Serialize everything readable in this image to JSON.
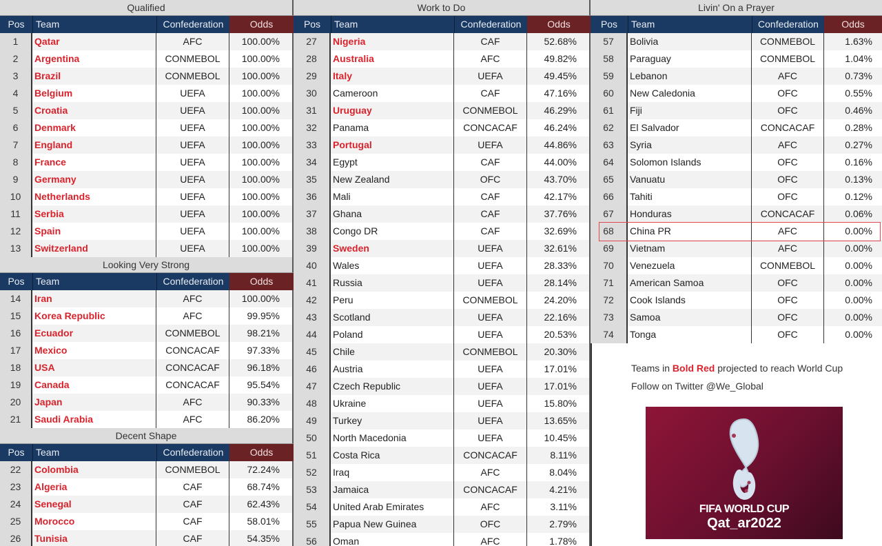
{
  "columns_header": {
    "pos": "Pos",
    "team": "Team",
    "confederation": "Confederation",
    "odds": "Odds"
  },
  "colors": {
    "bold_red": "#d9232c",
    "header_navy": "#1a3a63",
    "header_odds": "#6b2225",
    "highlight_box": "#e0484d"
  },
  "sections": {
    "qualified": {
      "title": "Qualified",
      "rows": [
        {
          "pos": "1",
          "team": "Qatar",
          "conf": "AFC",
          "odds": "100.00%",
          "bold_red": true
        },
        {
          "pos": "2",
          "team": "Argentina",
          "conf": "CONMEBOL",
          "odds": "100.00%",
          "bold_red": true
        },
        {
          "pos": "3",
          "team": "Brazil",
          "conf": "CONMEBOL",
          "odds": "100.00%",
          "bold_red": true
        },
        {
          "pos": "4",
          "team": "Belgium",
          "conf": "UEFA",
          "odds": "100.00%",
          "bold_red": true
        },
        {
          "pos": "5",
          "team": "Croatia",
          "conf": "UEFA",
          "odds": "100.00%",
          "bold_red": true
        },
        {
          "pos": "6",
          "team": "Denmark",
          "conf": "UEFA",
          "odds": "100.00%",
          "bold_red": true
        },
        {
          "pos": "7",
          "team": "England",
          "conf": "UEFA",
          "odds": "100.00%",
          "bold_red": true
        },
        {
          "pos": "8",
          "team": "France",
          "conf": "UEFA",
          "odds": "100.00%",
          "bold_red": true
        },
        {
          "pos": "9",
          "team": "Germany",
          "conf": "UEFA",
          "odds": "100.00%",
          "bold_red": true
        },
        {
          "pos": "10",
          "team": "Netherlands",
          "conf": "UEFA",
          "odds": "100.00%",
          "bold_red": true
        },
        {
          "pos": "11",
          "team": "Serbia",
          "conf": "UEFA",
          "odds": "100.00%",
          "bold_red": true
        },
        {
          "pos": "12",
          "team": "Spain",
          "conf": "UEFA",
          "odds": "100.00%",
          "bold_red": true
        },
        {
          "pos": "13",
          "team": "Switzerland",
          "conf": "UEFA",
          "odds": "100.00%",
          "bold_red": true
        }
      ]
    },
    "looking_very_strong": {
      "title": "Looking Very Strong",
      "rows": [
        {
          "pos": "14",
          "team": "Iran",
          "conf": "AFC",
          "odds": "100.00%",
          "bold_red": true
        },
        {
          "pos": "15",
          "team": "Korea Republic",
          "conf": "AFC",
          "odds": "99.95%",
          "bold_red": true
        },
        {
          "pos": "16",
          "team": "Ecuador",
          "conf": "CONMEBOL",
          "odds": "98.21%",
          "bold_red": true
        },
        {
          "pos": "17",
          "team": "Mexico",
          "conf": "CONCACAF",
          "odds": "97.33%",
          "bold_red": true
        },
        {
          "pos": "18",
          "team": "USA",
          "conf": "CONCACAF",
          "odds": "96.18%",
          "bold_red": true
        },
        {
          "pos": "19",
          "team": "Canada",
          "conf": "CONCACAF",
          "odds": "95.54%",
          "bold_red": true
        },
        {
          "pos": "20",
          "team": "Japan",
          "conf": "AFC",
          "odds": "90.33%",
          "bold_red": true
        },
        {
          "pos": "21",
          "team": "Saudi Arabia",
          "conf": "AFC",
          "odds": "86.20%",
          "bold_red": true
        }
      ]
    },
    "decent_shape": {
      "title": "Decent Shape",
      "rows": [
        {
          "pos": "22",
          "team": "Colombia",
          "conf": "CONMEBOL",
          "odds": "72.24%",
          "bold_red": true
        },
        {
          "pos": "23",
          "team": "Algeria",
          "conf": "CAF",
          "odds": "68.74%",
          "bold_red": true
        },
        {
          "pos": "24",
          "team": "Senegal",
          "conf": "CAF",
          "odds": "62.43%",
          "bold_red": true
        },
        {
          "pos": "25",
          "team": "Morocco",
          "conf": "CAF",
          "odds": "58.01%",
          "bold_red": true
        },
        {
          "pos": "26",
          "team": "Tunisia",
          "conf": "CAF",
          "odds": "54.35%",
          "bold_red": true
        }
      ]
    },
    "work_to_do": {
      "title": "Work to Do",
      "rows": [
        {
          "pos": "27",
          "team": "Nigeria",
          "conf": "CAF",
          "odds": "52.68%",
          "bold_red": true
        },
        {
          "pos": "28",
          "team": "Australia",
          "conf": "AFC",
          "odds": "49.82%",
          "bold_red": true
        },
        {
          "pos": "29",
          "team": "Italy",
          "conf": "UEFA",
          "odds": "49.45%",
          "bold_red": true
        },
        {
          "pos": "30",
          "team": "Cameroon",
          "conf": "CAF",
          "odds": "47.16%",
          "bold_red": false
        },
        {
          "pos": "31",
          "team": "Uruguay",
          "conf": "CONMEBOL",
          "odds": "46.29%",
          "bold_red": true
        },
        {
          "pos": "32",
          "team": "Panama",
          "conf": "CONCACAF",
          "odds": "46.24%",
          "bold_red": false
        },
        {
          "pos": "33",
          "team": "Portugal",
          "conf": "UEFA",
          "odds": "44.86%",
          "bold_red": true
        },
        {
          "pos": "34",
          "team": "Egypt",
          "conf": "CAF",
          "odds": "44.00%",
          "bold_red": false
        },
        {
          "pos": "35",
          "team": "New Zealand",
          "conf": "OFC",
          "odds": "43.70%",
          "bold_red": false
        },
        {
          "pos": "36",
          "team": "Mali",
          "conf": "CAF",
          "odds": "42.17%",
          "bold_red": false
        },
        {
          "pos": "37",
          "team": "Ghana",
          "conf": "CAF",
          "odds": "37.76%",
          "bold_red": false
        },
        {
          "pos": "38",
          "team": "Congo DR",
          "conf": "CAF",
          "odds": "32.69%",
          "bold_red": false
        },
        {
          "pos": "39",
          "team": "Sweden",
          "conf": "UEFA",
          "odds": "32.61%",
          "bold_red": true
        },
        {
          "pos": "40",
          "team": "Wales",
          "conf": "UEFA",
          "odds": "28.33%",
          "bold_red": false
        },
        {
          "pos": "41",
          "team": "Russia",
          "conf": "UEFA",
          "odds": "28.14%",
          "bold_red": false
        },
        {
          "pos": "42",
          "team": "Peru",
          "conf": "CONMEBOL",
          "odds": "24.20%",
          "bold_red": false
        },
        {
          "pos": "43",
          "team": "Scotland",
          "conf": "UEFA",
          "odds": "22.16%",
          "bold_red": false
        },
        {
          "pos": "44",
          "team": "Poland",
          "conf": "UEFA",
          "odds": "20.53%",
          "bold_red": false
        },
        {
          "pos": "45",
          "team": "Chile",
          "conf": "CONMEBOL",
          "odds": "20.30%",
          "bold_red": false
        },
        {
          "pos": "46",
          "team": "Austria",
          "conf": "UEFA",
          "odds": "17.01%",
          "bold_red": false
        },
        {
          "pos": "47",
          "team": "Czech Republic",
          "conf": "UEFA",
          "odds": "17.01%",
          "bold_red": false
        },
        {
          "pos": "48",
          "team": "Ukraine",
          "conf": "UEFA",
          "odds": "15.80%",
          "bold_red": false
        },
        {
          "pos": "49",
          "team": "Turkey",
          "conf": "UEFA",
          "odds": "13.65%",
          "bold_red": false
        },
        {
          "pos": "50",
          "team": "North Macedonia",
          "conf": "UEFA",
          "odds": "10.45%",
          "bold_red": false
        },
        {
          "pos": "51",
          "team": "Costa Rica",
          "conf": "CONCACAF",
          "odds": "8.11%",
          "bold_red": false
        },
        {
          "pos": "52",
          "team": "Iraq",
          "conf": "AFC",
          "odds": "8.04%",
          "bold_red": false
        },
        {
          "pos": "53",
          "team": "Jamaica",
          "conf": "CONCACAF",
          "odds": "4.21%",
          "bold_red": false
        },
        {
          "pos": "54",
          "team": "United Arab Emirates",
          "conf": "AFC",
          "odds": "3.11%",
          "bold_red": false
        },
        {
          "pos": "55",
          "team": "Papua New Guinea",
          "conf": "OFC",
          "odds": "2.79%",
          "bold_red": false
        },
        {
          "pos": "56",
          "team": "Oman",
          "conf": "AFC",
          "odds": "1.78%",
          "bold_red": false
        }
      ]
    },
    "livin_on_a_prayer": {
      "title": "Livin' On a Prayer",
      "highlighted_pos": "68",
      "rows": [
        {
          "pos": "57",
          "team": "Bolivia",
          "conf": "CONMEBOL",
          "odds": "1.63%",
          "bold_red": false
        },
        {
          "pos": "58",
          "team": "Paraguay",
          "conf": "CONMEBOL",
          "odds": "1.04%",
          "bold_red": false
        },
        {
          "pos": "59",
          "team": "Lebanon",
          "conf": "AFC",
          "odds": "0.73%",
          "bold_red": false
        },
        {
          "pos": "60",
          "team": "New Caledonia",
          "conf": "OFC",
          "odds": "0.55%",
          "bold_red": false
        },
        {
          "pos": "61",
          "team": "Fiji",
          "conf": "OFC",
          "odds": "0.46%",
          "bold_red": false
        },
        {
          "pos": "62",
          "team": "El Salvador",
          "conf": "CONCACAF",
          "odds": "0.28%",
          "bold_red": false
        },
        {
          "pos": "63",
          "team": "Syria",
          "conf": "AFC",
          "odds": "0.27%",
          "bold_red": false
        },
        {
          "pos": "64",
          "team": "Solomon Islands",
          "conf": "OFC",
          "odds": "0.16%",
          "bold_red": false
        },
        {
          "pos": "65",
          "team": "Vanuatu",
          "conf": "OFC",
          "odds": "0.13%",
          "bold_red": false
        },
        {
          "pos": "66",
          "team": "Tahiti",
          "conf": "OFC",
          "odds": "0.12%",
          "bold_red": false
        },
        {
          "pos": "67",
          "team": "Honduras",
          "conf": "CONCACAF",
          "odds": "0.06%",
          "bold_red": false
        },
        {
          "pos": "68",
          "team": "China PR",
          "conf": "AFC",
          "odds": "0.00%",
          "bold_red": false
        },
        {
          "pos": "69",
          "team": "Vietnam",
          "conf": "AFC",
          "odds": "0.00%",
          "bold_red": false
        },
        {
          "pos": "70",
          "team": "Venezuela",
          "conf": "CONMEBOL",
          "odds": "0.00%",
          "bold_red": false
        },
        {
          "pos": "71",
          "team": "American Samoa",
          "conf": "OFC",
          "odds": "0.00%",
          "bold_red": false
        },
        {
          "pos": "72",
          "team": "Cook Islands",
          "conf": "OFC",
          "odds": "0.00%",
          "bold_red": false
        },
        {
          "pos": "73",
          "team": "Samoa",
          "conf": "OFC",
          "odds": "0.00%",
          "bold_red": false
        },
        {
          "pos": "74",
          "team": "Tonga",
          "conf": "OFC",
          "odds": "0.00%",
          "bold_red": false
        }
      ]
    }
  },
  "notes": {
    "line1_prefix": "Teams in ",
    "line1_red": "Bold Red",
    "line1_suffix": " projected to reach World Cup",
    "line2": "Follow on Twitter @We_Global"
  },
  "logo": {
    "icon": "world-cup-emblem-icon",
    "line1": "FIFA WORLD CUP",
    "line2": "Qat_ar2022"
  }
}
